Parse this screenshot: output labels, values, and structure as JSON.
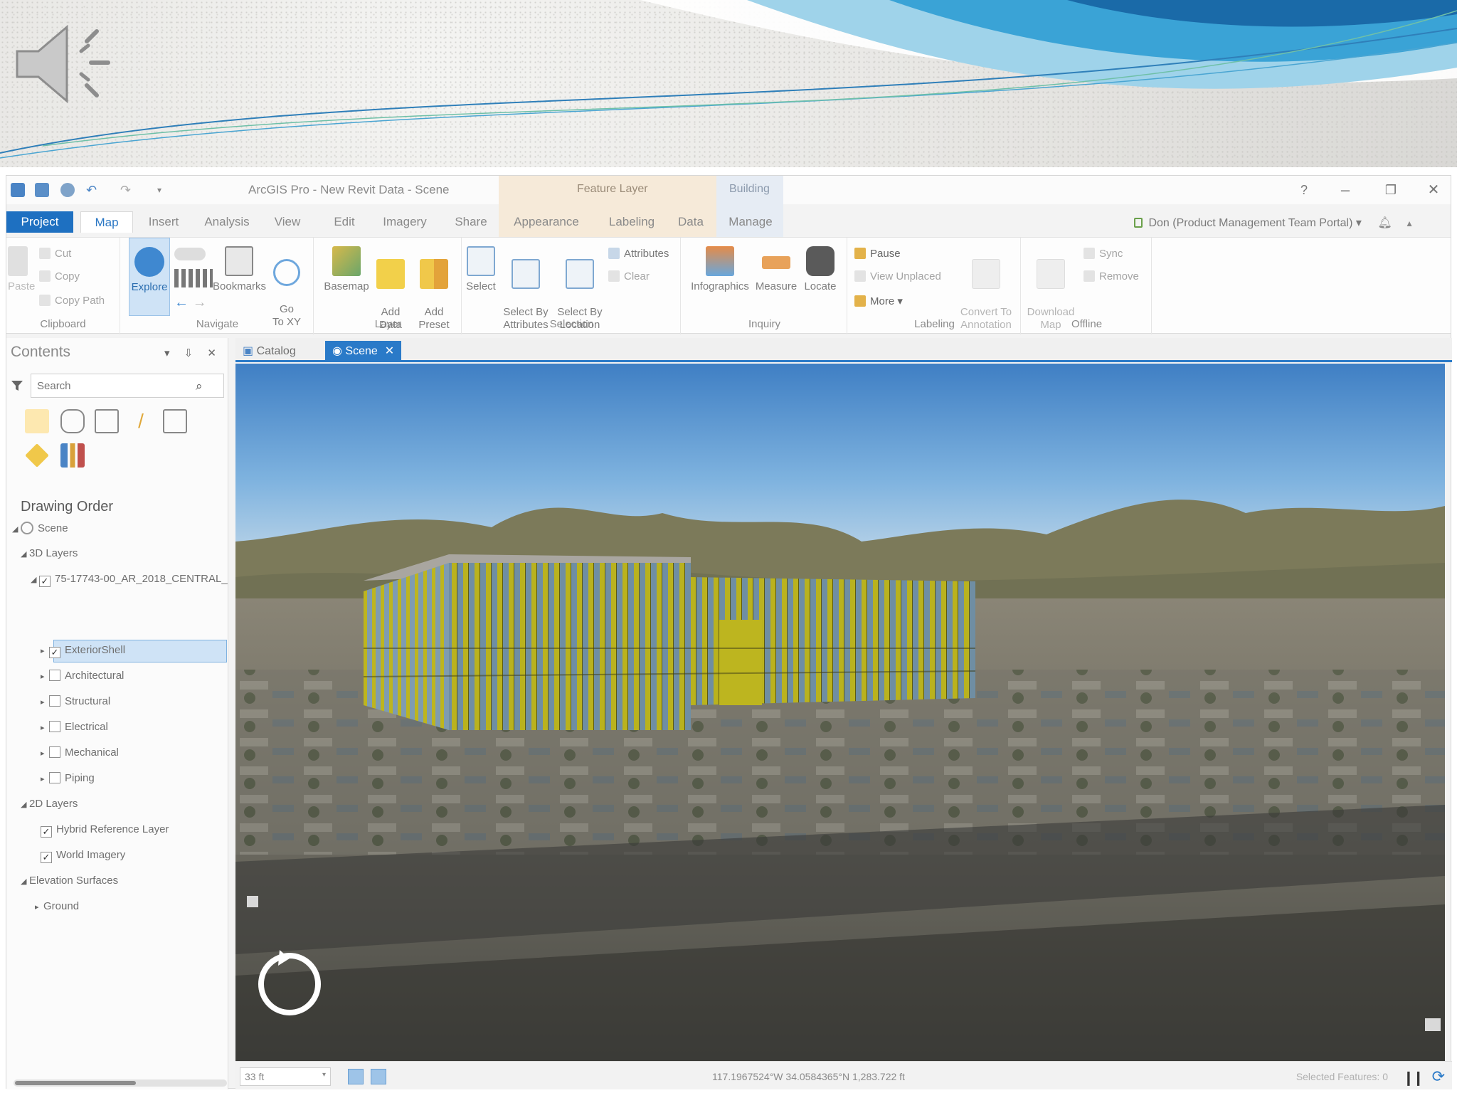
{
  "app": {
    "title": "ArcGIS Pro - New Revit Data - Scene",
    "context_tabs": {
      "feature_layer": "Feature Layer",
      "building": "Building"
    },
    "window_controls": {
      "help": "?",
      "minimize": "–",
      "restore": "❐",
      "close": "✕"
    }
  },
  "tabs": {
    "project": "Project",
    "map": "Map",
    "insert": "Insert",
    "analysis": "Analysis",
    "view": "View",
    "edit": "Edit",
    "imagery": "Imagery",
    "share": "Share",
    "appearance": "Appearance",
    "labeling": "Labeling",
    "data": "Data",
    "manage": "Manage"
  },
  "user": "Don (Product Management Team Portal) ▾",
  "ribbon": {
    "clipboard": {
      "label": "Clipboard",
      "paste": "Paste",
      "cut": "Cut",
      "copy": "Copy",
      "copy_path": "Copy Path"
    },
    "navigate": {
      "label": "Navigate",
      "explore": "Explore",
      "bookmarks": "Bookmarks",
      "goto": "Go\nTo XY"
    },
    "layer": {
      "label": "Layer",
      "basemap": "Basemap",
      "add_data": "Add\nData",
      "add_preset": "Add\nPreset"
    },
    "selection": {
      "label": "Selection",
      "select": "Select",
      "by_attributes": "Select By\nAttributes",
      "by_location": "Select By\nLocation",
      "attributes": "Attributes",
      "clear": "Clear"
    },
    "inquiry": {
      "label": "Inquiry",
      "infographics": "Infographics",
      "measure": "Measure",
      "locate": "Locate"
    },
    "labeling": {
      "label": "Labeling",
      "pause": "Pause",
      "view_unplaced": "View Unplaced",
      "more": "More",
      "convert": "Convert To\nAnnotation"
    },
    "offline": {
      "label": "Offline",
      "download": "Download\nMap",
      "sync": "Sync",
      "remove": "Remove"
    }
  },
  "contents": {
    "title": "Contents",
    "search_placeholder": "Search",
    "drawing_order": "Drawing Order",
    "tree": {
      "scene": "Scene",
      "layers_3d": "3D Layers",
      "model": "75-17743-00_AR_2018_CENTRAL_",
      "exterior_shell": "ExteriorShell",
      "architectural": "Architectural",
      "structural": "Structural",
      "electrical": "Electrical",
      "mechanical": "Mechanical",
      "piping": "Piping",
      "layers_2d": "2D Layers",
      "hybrid_ref": "Hybrid Reference Layer",
      "world_imagery": "World Imagery",
      "elevation": "Elevation Surfaces",
      "ground": "Ground"
    }
  },
  "view_tabs": {
    "catalog": "Catalog",
    "scene": "Scene"
  },
  "status": {
    "scale": "33 ft",
    "coordinates": "117.1967524°W 34.0584365°N    1,283.722 ft",
    "selected_features": "Selected Features: 0"
  },
  "colors": {
    "accent": "#1e70c1",
    "building": "#b9b21e",
    "sky_top": "#3f7fc4"
  }
}
